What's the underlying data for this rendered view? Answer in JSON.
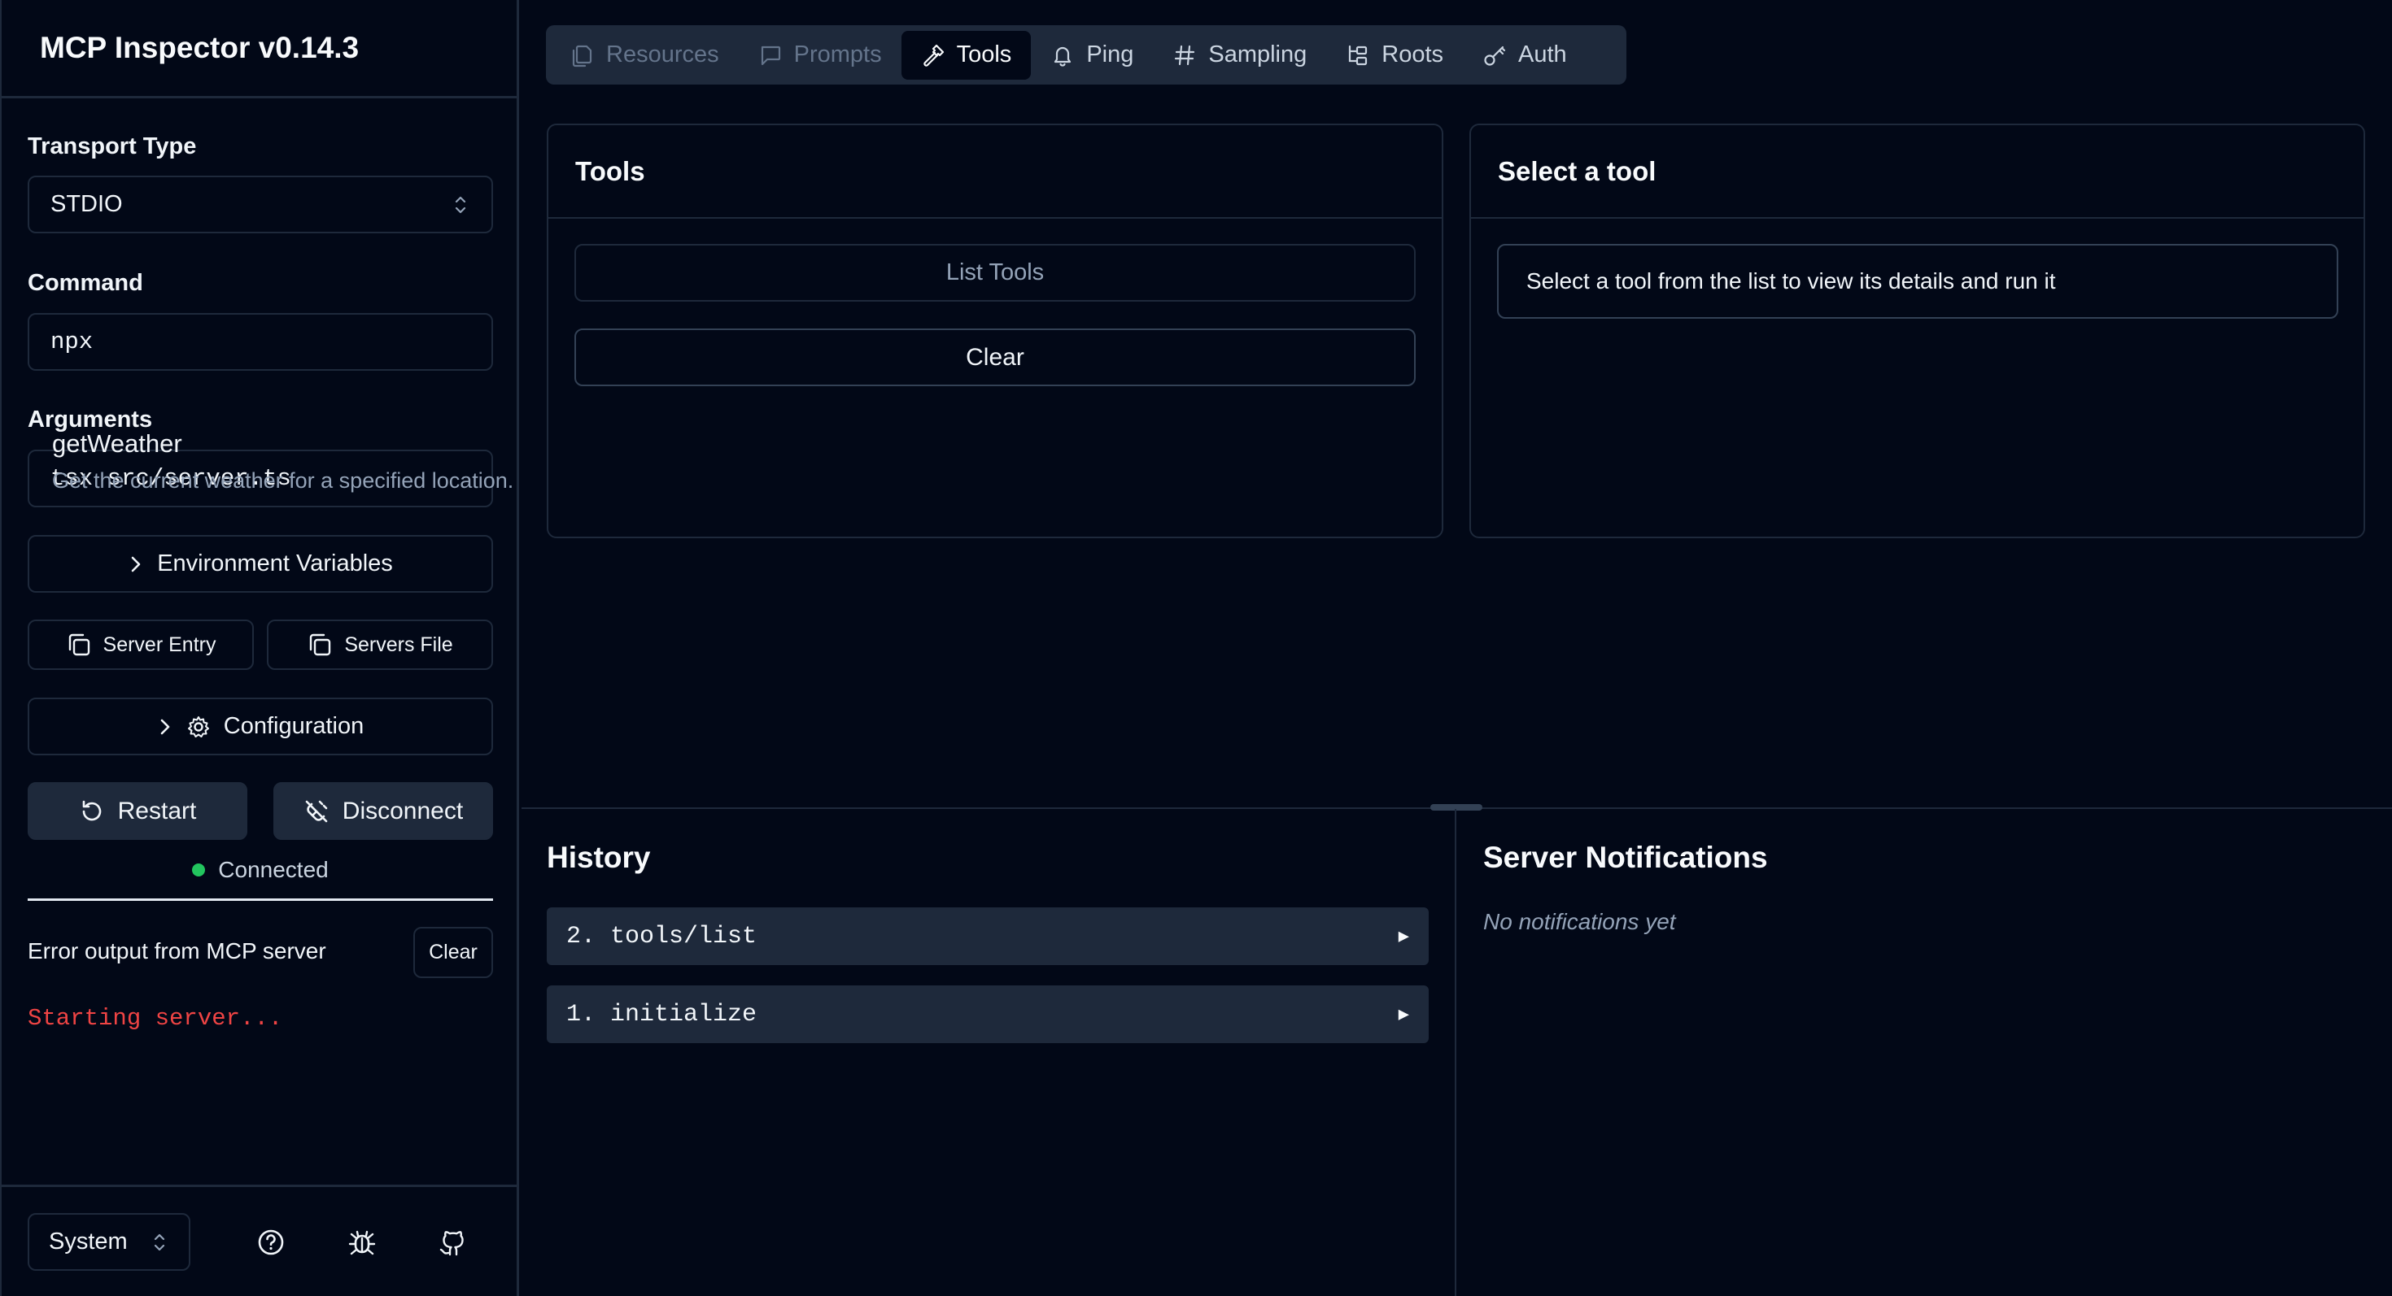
{
  "app": {
    "title": "MCP Inspector v0.14.3"
  },
  "sidebar": {
    "transport_label": "Transport Type",
    "transport_value": "STDIO",
    "command_label": "Command",
    "command_value": "npx",
    "arguments_label": "Arguments",
    "arguments_value": "tsx src/server.ts",
    "env_button": "Environment Variables",
    "server_entry_button": "Server Entry",
    "servers_file_button": "Servers File",
    "config_button": "Configuration",
    "restart_button": "Restart",
    "disconnect_button": "Disconnect",
    "status_text": "Connected",
    "status_color": "#22c55e",
    "error_label": "Error output from MCP server",
    "error_clear": "Clear",
    "error_output": "Starting server...",
    "error_color": "#ef4444",
    "theme_value": "System",
    "footer_icons": [
      "help-icon",
      "bug-icon",
      "github-icon"
    ]
  },
  "tabs": [
    {
      "label": "Resources",
      "icon": "files-icon",
      "state": "disabled"
    },
    {
      "label": "Prompts",
      "icon": "message-icon",
      "state": "disabled"
    },
    {
      "label": "Tools",
      "icon": "hammer-icon",
      "state": "active"
    },
    {
      "label": "Ping",
      "icon": "bell-icon",
      "state": "enabled"
    },
    {
      "label": "Sampling",
      "icon": "hash-icon",
      "state": "enabled"
    },
    {
      "label": "Roots",
      "icon": "folder-tree-icon",
      "state": "enabled"
    },
    {
      "label": "Auth",
      "icon": "key-icon",
      "state": "enabled"
    }
  ],
  "tools_panel": {
    "title": "Tools",
    "list_button": "List Tools",
    "clear_button": "Clear",
    "tools": [
      {
        "name": "getWeather",
        "description": "Get the current weather for a specified location."
      }
    ]
  },
  "tool_detail": {
    "title": "Select a tool",
    "hint": "Select a tool from the list to view its details and run it"
  },
  "history": {
    "title": "History",
    "items": [
      {
        "label": "2. tools/list"
      },
      {
        "label": "1. initialize"
      }
    ]
  },
  "notifications": {
    "title": "Server Notifications",
    "empty_text": "No notifications yet"
  }
}
